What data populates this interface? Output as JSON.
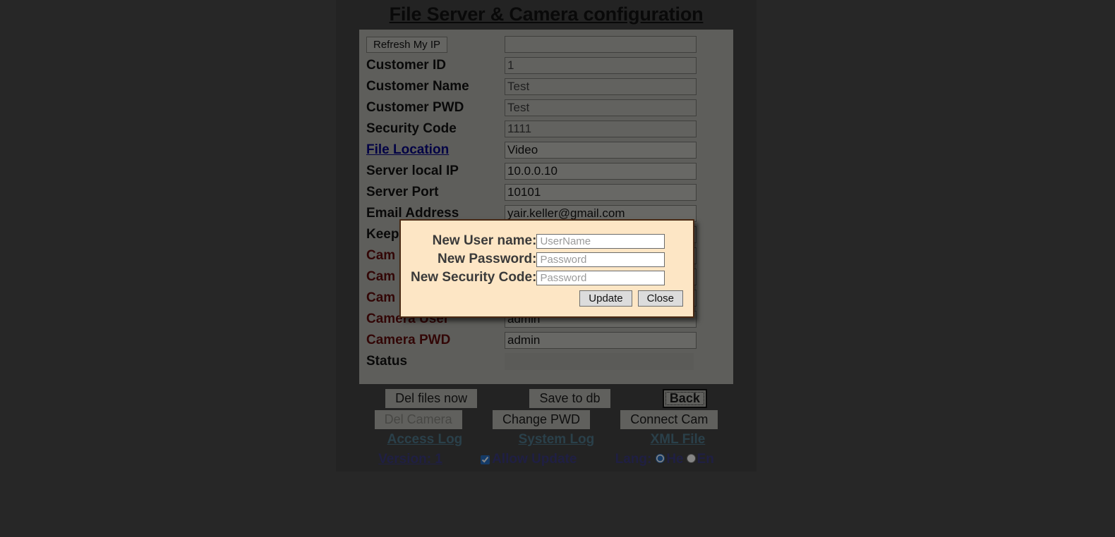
{
  "page": {
    "title": "File Server & Camera configuration",
    "colors": {
      "backdrop": "#272727",
      "content": "#434343",
      "panel": "#B6B6AC",
      "modal_bg": "#FDE6C5",
      "modal_border": "#4a2a14",
      "label": "#111111",
      "label_red": "#8a0000",
      "link_blue": "#3838a8",
      "link_teal": "#3c7fa0"
    }
  },
  "form": {
    "refresh_button": "Refresh My IP",
    "my_ip_value": "",
    "rows": [
      {
        "label": "Customer ID",
        "value": "1",
        "style": "dull",
        "kind": "text"
      },
      {
        "label": "Customer Name",
        "value": "Test",
        "style": "dull",
        "kind": "text"
      },
      {
        "label": "Customer PWD",
        "value": "Test",
        "style": "dull",
        "kind": "text"
      },
      {
        "label": "Security Code",
        "value": "1111",
        "style": "dull",
        "kind": "text"
      },
      {
        "label": "File Location",
        "value": "Video",
        "style": "link",
        "kind": "text"
      },
      {
        "label": "Server local IP",
        "value": "10.0.0.10",
        "style": "plain",
        "kind": "text"
      },
      {
        "label": "Server Port",
        "value": "10101",
        "style": "plain",
        "kind": "text"
      },
      {
        "label": "Email Address",
        "value": "yair.keller@gmail.com",
        "style": "plain",
        "kind": "text"
      },
      {
        "label": "Keep",
        "value": "",
        "style": "plain",
        "kind": "text"
      },
      {
        "label": "Cam",
        "value": "",
        "style": "red",
        "kind": "text"
      },
      {
        "label": "Cam",
        "value": "",
        "style": "red",
        "kind": "text"
      },
      {
        "label": "Cam",
        "value": "",
        "style": "red",
        "kind": "text"
      },
      {
        "label": "Camera User",
        "value": "admin",
        "style": "red",
        "kind": "text"
      },
      {
        "label": "Camera PWD",
        "value": "admin",
        "style": "red",
        "kind": "text"
      },
      {
        "label": "Status",
        "value": "",
        "style": "status",
        "kind": "text"
      }
    ]
  },
  "actions": {
    "row1": [
      {
        "label": "Del files now",
        "state": "enabled"
      },
      {
        "label": "Save to db",
        "state": "enabled"
      },
      {
        "label": "Back",
        "state": "focused"
      }
    ],
    "row2": [
      {
        "label": "Del Camera",
        "state": "disabled"
      },
      {
        "label": "Change PWD",
        "state": "enabled"
      },
      {
        "label": "Connect Cam",
        "state": "enabled"
      }
    ]
  },
  "links": {
    "row1": [
      {
        "label": "Access Log"
      },
      {
        "label": "System Log"
      },
      {
        "label": "XML File"
      }
    ],
    "version_label": "Version: 1",
    "allow_update_label": "Allow Update",
    "allow_update_checked": true,
    "lang_label": "Lang:",
    "lang_options": [
      {
        "label": "He",
        "selected": true
      },
      {
        "label": "En",
        "selected": false
      }
    ]
  },
  "modal": {
    "fields": [
      {
        "label": "New User name:",
        "placeholder": "UserName",
        "value": ""
      },
      {
        "label": "New Password:",
        "placeholder": "Password",
        "value": ""
      },
      {
        "label": "New Security Code:",
        "placeholder": "Password",
        "value": ""
      }
    ],
    "update_button": "Update",
    "close_button": "Close"
  }
}
